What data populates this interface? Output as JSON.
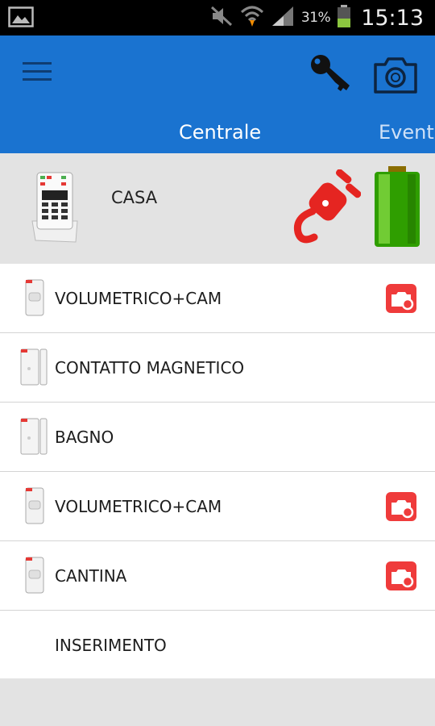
{
  "status_bar": {
    "battery_percent": "31%",
    "time": "15:13",
    "icons": [
      "image-icon",
      "mute-icon",
      "wifi-icon",
      "signal-icon",
      "battery-icon"
    ]
  },
  "app_bar": {
    "menu_icon": "hamburger-menu-icon",
    "actions": [
      "key-icon",
      "camera-icon"
    ],
    "tabs": [
      {
        "label": "Centrale",
        "selected": true
      },
      {
        "label": "Eventi",
        "selected": false
      }
    ],
    "color": "#1a73d0"
  },
  "hub": {
    "label": "CASA",
    "icons": [
      "control-panel-icon",
      "power-plug-icon",
      "battery-full-icon"
    ]
  },
  "devices": [
    {
      "label": "VOLUMETRICO+CAM",
      "icon": "motion-sensor-icon",
      "has_camera": true
    },
    {
      "label": "CONTATTO MAGNETICO",
      "icon": "door-contact-icon",
      "has_camera": false
    },
    {
      "label": "BAGNO",
      "icon": "door-contact-icon",
      "has_camera": false
    },
    {
      "label": "VOLUMETRICO+CAM",
      "icon": "motion-sensor-icon",
      "has_camera": true
    },
    {
      "label": "CANTINA",
      "icon": "motion-sensor-icon",
      "has_camera": true
    },
    {
      "label": "INSERIMENTO",
      "icon": "",
      "has_camera": false
    }
  ]
}
